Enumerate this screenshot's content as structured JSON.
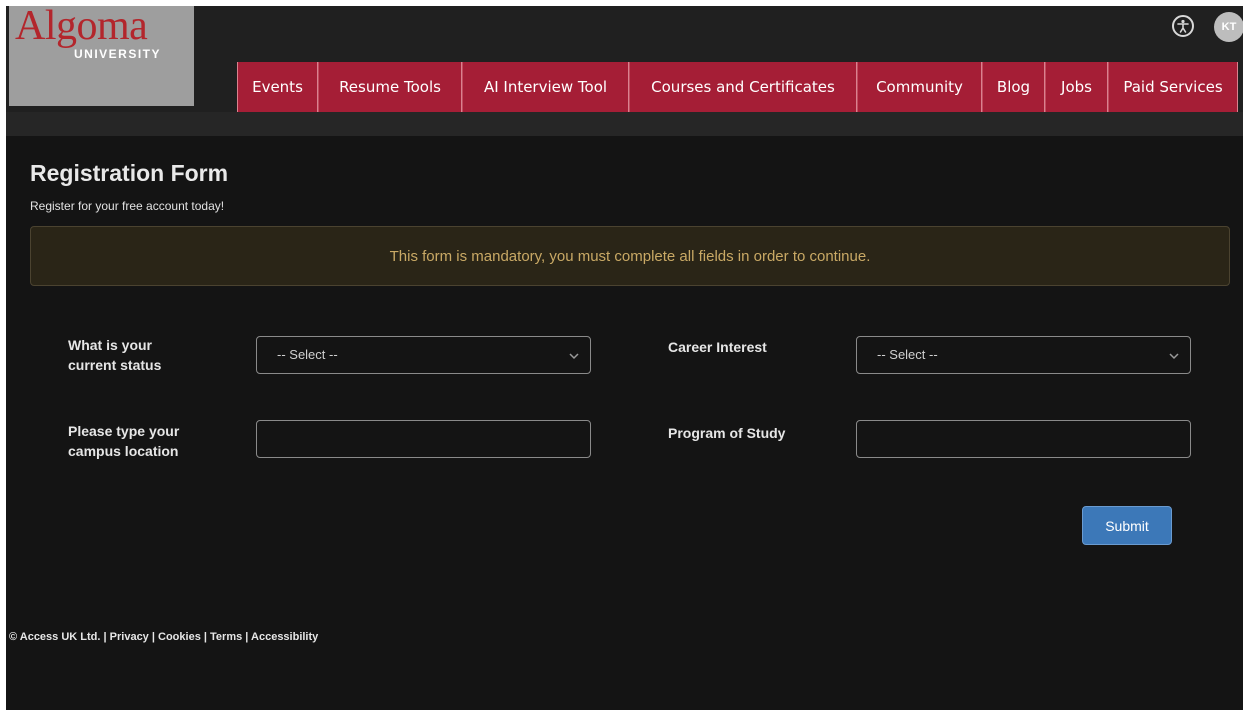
{
  "header": {
    "logo": {
      "main": "Algoma",
      "sub": "UNIVERSITY"
    },
    "nav": [
      {
        "label": "Events",
        "name": "nav-events",
        "w": 81
      },
      {
        "label": "Resume Tools",
        "name": "nav-resume-tools",
        "w": 144
      },
      {
        "label": "AI Interview Tool",
        "name": "nav-ai-interview-tool",
        "w": 167
      },
      {
        "label": "Courses and Certificates",
        "name": "nav-courses-and-certificates",
        "w": 228
      },
      {
        "label": "Community",
        "name": "nav-community",
        "w": 125
      },
      {
        "label": "Blog",
        "name": "nav-blog",
        "w": 63
      },
      {
        "label": "Jobs",
        "name": "nav-jobs",
        "w": 63
      },
      {
        "label": "Paid Services",
        "name": "nav-paid-services",
        "w": 130
      }
    ],
    "user_initials": "KT"
  },
  "main": {
    "title": "Registration Form",
    "subtitle": "Register for your free account today!",
    "alert": "This form is mandatory, you must complete all fields in order to continue.",
    "fields": {
      "status": {
        "label_line1": "What is your",
        "label_line2": "current status",
        "value": "-- Select --"
      },
      "career": {
        "label": "Career Interest",
        "value": "-- Select --"
      },
      "campus": {
        "label_line1": "Please type your",
        "label_line2": "campus location",
        "value": ""
      },
      "program": {
        "label": "Program of Study",
        "value": ""
      }
    },
    "submit_label": "Submit"
  },
  "footer": {
    "copyright": "© Access UK Ltd.",
    "sep": "|",
    "links": [
      "Privacy",
      "Cookies",
      "Terms",
      "Accessibility"
    ]
  },
  "colors": {
    "brand_red": "#a51e36",
    "button_blue": "#3c78b8",
    "alert_text": "#c9a965"
  },
  "icons": [
    "accessibility-icon",
    "chevron-down-icon"
  ]
}
